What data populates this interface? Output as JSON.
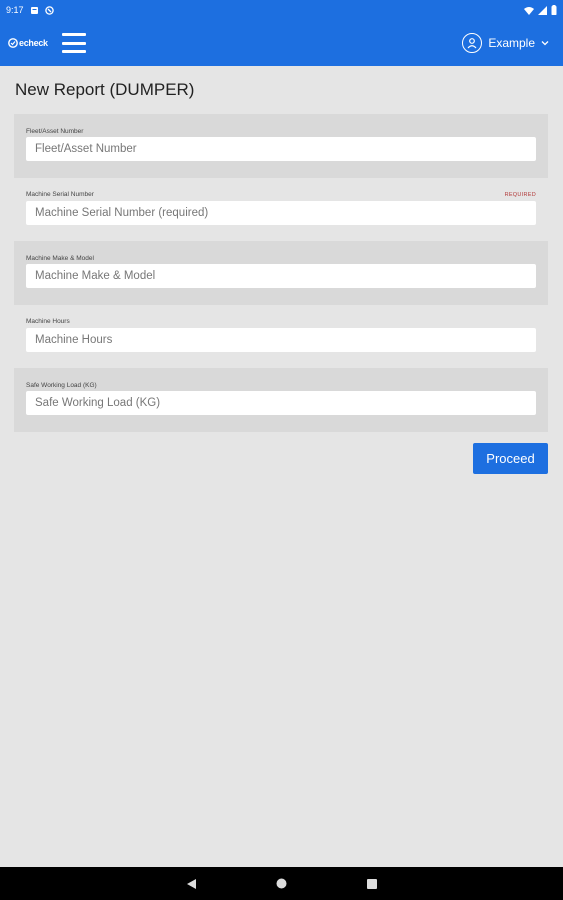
{
  "status_bar": {
    "time": "9:17"
  },
  "app_bar": {
    "logo_text": "echeck",
    "user_name": "Example"
  },
  "page": {
    "title": "New Report (DUMPER)"
  },
  "form": {
    "fields": [
      {
        "label": "Fleet/Asset Number",
        "placeholder": "Fleet/Asset Number",
        "required_tag": ""
      },
      {
        "label": "Machine Serial Number",
        "placeholder": "Machine Serial Number (required)",
        "required_tag": "REQUIRED"
      },
      {
        "label": "Machine Make & Model",
        "placeholder": "Machine Make & Model",
        "required_tag": ""
      },
      {
        "label": "Machine Hours",
        "placeholder": "Machine Hours",
        "required_tag": ""
      },
      {
        "label": "Safe Working Load (KG)",
        "placeholder": "Safe Working Load (KG)",
        "required_tag": ""
      }
    ],
    "proceed_label": "Proceed"
  },
  "colors": {
    "primary": "#1d6fe0",
    "required": "#b23a3a",
    "background": "#e5e5e5",
    "row_alt": "#d9d9d9"
  },
  "icons": {
    "status_left": [
      "notification-icon",
      "sync-icon"
    ],
    "status_right": [
      "wifi-icon",
      "signal-icon",
      "battery-icon"
    ],
    "nav": [
      "back-icon",
      "home-icon",
      "recents-icon"
    ]
  }
}
